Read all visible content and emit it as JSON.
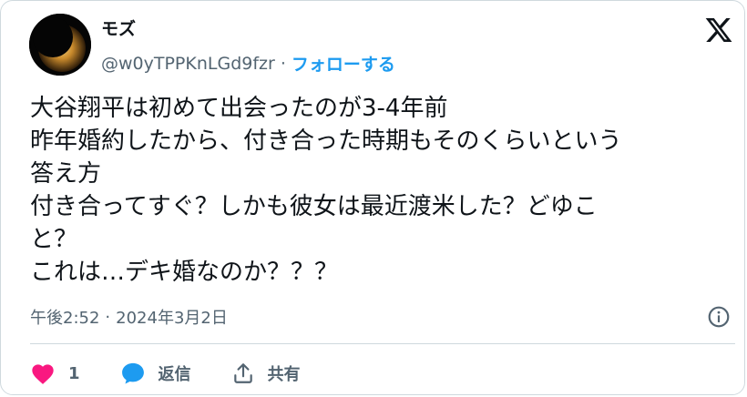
{
  "user": {
    "display_name": "モズ",
    "handle": "@w0yTPPKnLGd9fzr",
    "separator": "·",
    "follow_label": "フォローする"
  },
  "tweet": {
    "lines": [
      "大谷翔平は初めて出会ったのが3-4年前",
      "昨年婚約したから、付き合った時期もそのくらいという",
      "答え方",
      "付き合ってすぐ？しかも彼女は最近渡米した？どゆこ",
      "と？",
      "これは…デキ婚なのか？？？"
    ],
    "time": "午後2:52",
    "meta_separator": "·",
    "date": "2024年3月2日"
  },
  "actions": {
    "like_count": "1",
    "reply_label": "返信",
    "share_label": "共有"
  },
  "icons": {
    "logo": "x-logo-icon",
    "info": "info-icon",
    "like": "heart-icon",
    "reply": "speech-bubble-icon",
    "share": "share-icon"
  },
  "colors": {
    "text": "#0f1419",
    "secondary": "#536471",
    "accent": "#1d9bf0",
    "like": "#f91880",
    "border": "#cfd9de"
  }
}
